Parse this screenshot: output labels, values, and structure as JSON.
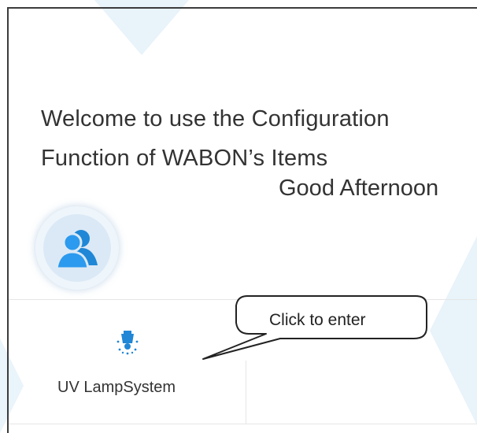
{
  "welcome": {
    "line1": "Welcome to use the Configuration",
    "line2": "Function of WABON’s Items",
    "greeting": "Good Afternoon"
  },
  "user": {
    "avatar_icon": "users-icon"
  },
  "tiles": [
    {
      "label": "UV LampSystem",
      "icon": "lamp-icon"
    }
  ],
  "callout": {
    "text": "Click to enter"
  },
  "colors": {
    "accent": "#1f87d6",
    "text": "#333333",
    "frame": "#3c3c3c"
  }
}
